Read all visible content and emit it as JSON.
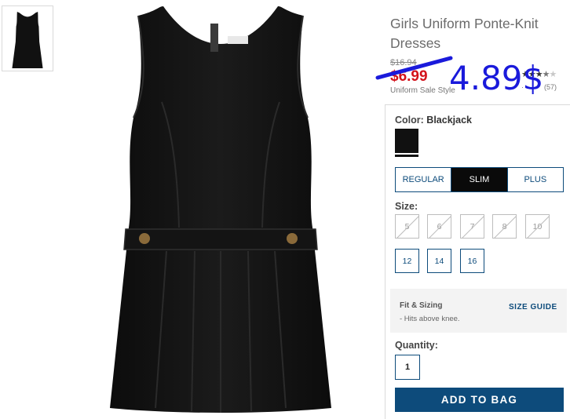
{
  "product": {
    "title": "Girls Uniform Ponte-Knit Dresses",
    "old_price": "$16.94",
    "sale_price": "$6.99",
    "sale_style": "Uniform Sale Style",
    "rating_stars": 3.5,
    "rating_count": "(57)",
    "rating_dot": "·"
  },
  "overlay": {
    "price": "4.89$",
    "color": "#1a1adb"
  },
  "color": {
    "label": "Color:",
    "value": "Blackjack",
    "swatch_color": "#111111"
  },
  "fit": {
    "options": [
      "REGULAR",
      "SLIM",
      "PLUS"
    ],
    "selected": "SLIM"
  },
  "size": {
    "label": "Size:",
    "unavailable": [
      "5",
      "6",
      "7",
      "8",
      "10"
    ],
    "available": [
      "12",
      "14",
      "16"
    ]
  },
  "fit_sizing": {
    "title": "Fit & Sizing",
    "note": "- Hits above knee.",
    "guide_link": "SIZE GUIDE"
  },
  "quantity": {
    "label": "Quantity:",
    "value": "1"
  },
  "cart": {
    "add_label": "ADD TO BAG"
  },
  "colors": {
    "brand": "#0d4b7b",
    "sale_red": "#d3121b"
  }
}
